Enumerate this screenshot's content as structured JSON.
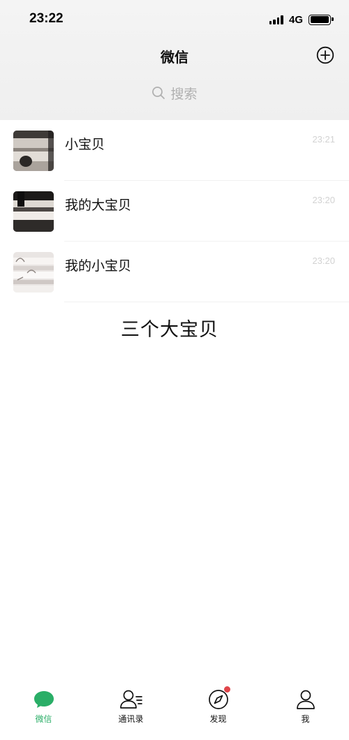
{
  "status": {
    "time": "23:22",
    "network": "4G"
  },
  "nav": {
    "title": "微信"
  },
  "search": {
    "placeholder": "搜索"
  },
  "chats": [
    {
      "name": "小宝贝",
      "time": "23:21"
    },
    {
      "name": "我的大宝贝",
      "time": "23:20"
    },
    {
      "name": "我的小宝贝",
      "time": "23:20"
    }
  ],
  "caption": "三个大宝贝",
  "tabs": [
    {
      "label": "微信",
      "icon": "chat-bubble-icon",
      "active": true
    },
    {
      "label": "通讯录",
      "icon": "contacts-icon"
    },
    {
      "label": "发现",
      "icon": "compass-icon",
      "badge": "red-dot"
    },
    {
      "label": "我",
      "icon": "person-icon"
    }
  ],
  "colors": {
    "accent": "#2aae67",
    "badge": "#e0454a",
    "header_bg": "#f2f2f2"
  }
}
